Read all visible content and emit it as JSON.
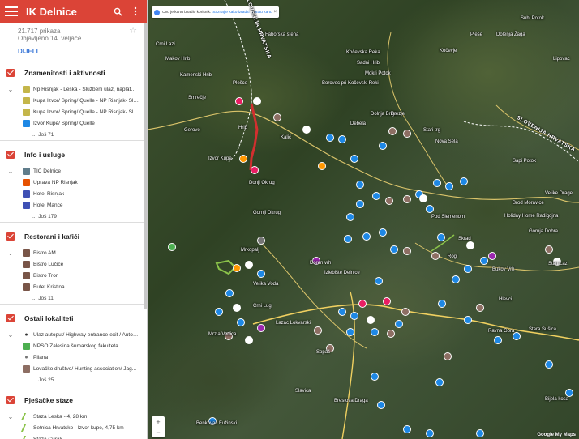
{
  "app": {
    "title": "IK Delnice",
    "views": "21.717 prikaza",
    "published": "Objavljeno 14. veljače",
    "share_label": "DIJELI"
  },
  "layers": [
    {
      "title": "Znamenitosti i aktivnosti",
      "items": [
        {
          "text": "Np Risnjak - Leska - Službeni ulaz, naplata ul...",
          "icon": "park-icon",
          "color": "#c4b64a"
        },
        {
          "text": "Kupa Izvor/ Spring/ Quelle - NP Risnjak- Služ...",
          "icon": "park-icon",
          "color": "#c4b64a"
        },
        {
          "text": "Kupa Izvor/ Spring/ Quelle - NP Risnjak- Služ...",
          "icon": "park-icon",
          "color": "#c4b64a"
        },
        {
          "text": "Izvor Kupe/ Spring/ Quelle",
          "icon": "water-icon",
          "color": "#1e88e5"
        }
      ],
      "more": "... Još 71"
    },
    {
      "title": "Info i usluge",
      "items": [
        {
          "text": "TIC Delnice",
          "icon": "info-icon",
          "color": "#607d8b"
        },
        {
          "text": "Uprava NP Risnjak",
          "icon": "admin-icon",
          "color": "#e65100"
        },
        {
          "text": "Hotel Risnjak",
          "icon": "hotel-icon",
          "color": "#3f51b5"
        },
        {
          "text": "Hotel Mance",
          "icon": "hotel-icon",
          "color": "#3f51b5"
        }
      ],
      "more": "... Još 179"
    },
    {
      "title": "Restorani i kafići",
      "items": [
        {
          "text": "Bistro AM",
          "icon": "restaurant-icon",
          "color": "#795548"
        },
        {
          "text": "Bistro Lučice",
          "icon": "restaurant-icon",
          "color": "#795548"
        },
        {
          "text": "Bistro Tron",
          "icon": "restaurant-icon",
          "color": "#795548"
        },
        {
          "text": "Bufet Kristina",
          "icon": "restaurant-icon",
          "color": "#795548"
        }
      ],
      "more": "... Još 11"
    },
    {
      "title": "Ostali lokaliteti",
      "items": [
        {
          "text": "Ulaz autoput/ Highway entrance-exit / Autob...",
          "icon": "pin-icon",
          "color": "#333"
        },
        {
          "text": "NPŠO Zalesina šumarskog fakulteta",
          "icon": "forest-icon",
          "color": "#4caf50"
        },
        {
          "text": "Pilana",
          "icon": "pin-icon",
          "color": "#757575"
        },
        {
          "text": "Lovačko društvo/ Hunting association/ Jag...",
          "icon": "hunting-icon",
          "color": "#8d6e63"
        }
      ],
      "more": "... Još 25"
    },
    {
      "title": "Pješačke staze",
      "items": [
        {
          "text": "Staza Leska - 4, 28 km",
          "icon": "trail-icon",
          "color": "#8bc34a"
        },
        {
          "text": "Šetnica Hrvatsko - Izvor kupe, 4,75 km",
          "icon": "trail-icon",
          "color": "#8bc34a"
        },
        {
          "text": "Staza Curak",
          "icon": "trail-icon",
          "color": "#8bc34a"
        },
        {
          "text": "Staza medvjeda",
          "icon": "trail-icon",
          "color": "#8bc34a"
        }
      ]
    }
  ],
  "map": {
    "banner_text": "Ovu je kartu izradio korisnik.",
    "banner_link": "Saznajte kako izraditi vlastitu kartu",
    "zoom_in": "+",
    "zoom_out": "−",
    "attribution": "Google My Maps",
    "labels": {
      "makov_hrib": "Makov Hrib",
      "crni_lazi": "Crni Lazi",
      "slovenija_hrvatska": "SLOVENIJA HRVATSKA",
      "faborska_stena": "Faborska stena",
      "kocevska_reka": "Kočevska Reka",
      "sadni_hrib": "Sadni Hrib",
      "mokri_potok": "Mokri Potok",
      "borovec": "Borovec pri Kočevski Reki",
      "kamenski_hrib": "Kamenski Hrib",
      "plesce": "Plešce",
      "smrecje": "Smrečje",
      "gerovo": "Gerovo",
      "hrib": "Hrib",
      "kalic": "Kalić",
      "izvor_kupe": "Izvor Kupe",
      "donji_okrug": "Donji Okrug",
      "gornji_okrug": "Gornji Okrug",
      "mrkopalj": "Mrkopalj",
      "doren_vrh": "Doren vrh",
      "velika_voda": "Velika Voda",
      "crni_lug": "Crni Lug",
      "mrzla_vodica": "Mrzla Vodica",
      "lazac_lokvarski": "Lazac Lokvarski",
      "skrad": "Skrad",
      "rogi": "Rogi",
      "delnice": "Izlebište Delnice",
      "stari_laz": "Stari Laz",
      "sopac": "Sopač",
      "slavica": "Slavica",
      "brestova_draga": "Brestova Draga",
      "benkovac_fuzinski": "Benkovac Fužinski",
      "brod_moravice": "Brod Moravice",
      "velike_drage": "Velike Drage",
      "holiday_home": "Holiday Home Radigojna",
      "gornja_dobra": "Gornja Dobra",
      "stara_sušica": "Stara Sušica",
      "bjela_kosa": "Bijela kosa",
      "dolnja_briga": "Dolnja Briga",
      "debela": "Debela",
      "brezje": "Brezje",
      "sapi_potok": "Sapi Potok",
      "kocevje": "Kočevje",
      "stari_trg": "Stari trg",
      "nova_sela": "Nova Sela",
      "slovenija_hrvatska_2": "SLOVENIJA HRVATSKA",
      "suhi_potok": "Suhi Potok",
      "dolenja": "Dolenja Žaga",
      "lipovac": "Lipovac",
      "bukov_vrh": "Bukov Vrh",
      "plesce2": "Pleše",
      "hlevci": "Hlevci",
      "ravna_gora": "Ravna Gora",
      "podslemе": "Pod Slemenom"
    }
  }
}
